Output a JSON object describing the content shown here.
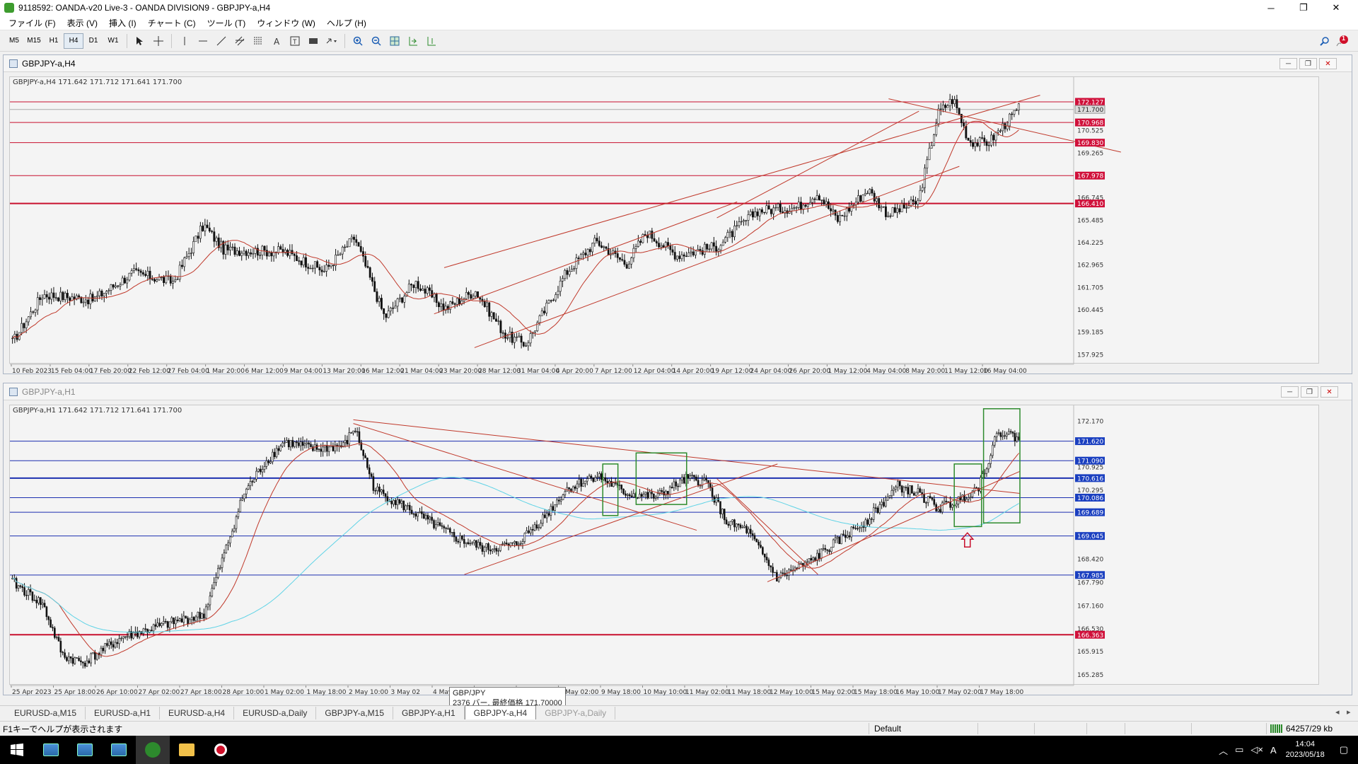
{
  "window": {
    "title": "9118592: OANDA-v20 Live-3 - OANDA DIVISION9 - GBPJPY-a,H4",
    "controls": {
      "minimize": "─",
      "restore": "❐",
      "close": "✕"
    }
  },
  "menu": [
    "ファイル (F)",
    "表示 (V)",
    "挿入 (I)",
    "チャート (C)",
    "ツール (T)",
    "ウィンドウ (W)",
    "ヘルプ (H)"
  ],
  "toolbar": {
    "timeframes": [
      "M5",
      "M15",
      "H1",
      "H4",
      "D1",
      "W1"
    ],
    "active_timeframe": "H4",
    "notification_count": "1"
  },
  "top_chart": {
    "window_title": "GBPJPY-a,H4",
    "info_line": "GBPJPY-a,H4  171.642 171.712 171.641 171.700",
    "price_axis": [
      "172.127",
      "171.700",
      "170.968",
      "170.525",
      "169.830",
      "169.265",
      "167.978",
      "166.745",
      "166.410",
      "165.485",
      "164.225",
      "162.965",
      "161.705",
      "160.445",
      "159.185",
      "157.925"
    ],
    "highlighted_prices": [
      "172.127",
      "170.968",
      "169.830",
      "167.978",
      "166.410"
    ],
    "current_price": "171.700",
    "time_axis": [
      "10 Feb 2023",
      "15 Feb 04:00",
      "17 Feb 20:00",
      "22 Feb 12:00",
      "27 Feb 04:00",
      "1 Mar 20:00",
      "6 Mar 12:00",
      "9 Mar 04:00",
      "13 Mar 20:00",
      "16 Mar 12:00",
      "21 Mar 04:00",
      "23 Mar 20:00",
      "28 Mar 12:00",
      "31 Mar 04:00",
      "4 Apr 20:00",
      "7 Apr 12:00",
      "12 Apr 04:00",
      "14 Apr 20:00",
      "19 Apr 12:00",
      "24 Apr 04:00",
      "26 Apr 20:00",
      "1 May 12:00",
      "4 May 04:00",
      "8 May 20:00",
      "11 May 12:00",
      "16 May 04:00"
    ]
  },
  "bottom_chart": {
    "window_title": "GBPJPY-a,H1",
    "info_line": "GBPJPY-a,H1  171.642 171.712 171.641 171.700",
    "price_axis": [
      "172.170",
      "171.620",
      "171.090",
      "170.925",
      "170.616",
      "170.295",
      "170.086",
      "169.689",
      "169.045",
      "168.420",
      "167.985",
      "167.790",
      "167.160",
      "166.530",
      "166.363",
      "165.915",
      "165.285"
    ],
    "highlighted_prices": [
      "171.620",
      "171.090",
      "170.616",
      "170.086",
      "169.689",
      "169.045",
      "167.985",
      "166.363"
    ],
    "time_axis": [
      "25 Apr 2023",
      "25 Apr 18:00",
      "26 Apr 10:00",
      "27 Apr 02:00",
      "27 Apr 18:00",
      "28 Apr 10:00",
      "1 May 02:00",
      "1 May 18:00",
      "2 May 10:00",
      "3 May 02",
      "4 May 02:00",
      "5 May 18:00",
      "8 May 10:00",
      "9 May 02:00",
      "9 May 18:00",
      "10 May 10:00",
      "11 May 02:00",
      "11 May 18:00",
      "12 May 10:00",
      "15 May 02:00",
      "15 May 18:00",
      "16 May 10:00",
      "17 May 02:00",
      "17 May 18:00"
    ],
    "tooltip": {
      "line1": "GBP/JPY",
      "line2": "2376 バー, 最終価格 171.70000"
    }
  },
  "tabs": [
    "EURUSD-a,M15",
    "EURUSD-a,H1",
    "EURUSD-a,H4",
    "EURUSD-a,Daily",
    "GBPJPY-a,M15",
    "GBPJPY-a,H1",
    "GBPJPY-a,H4",
    "GBPJPY-a,Daily"
  ],
  "active_tab": "GBPJPY-a,H4",
  "status": {
    "help_text": "F1キーでヘルプが表示されます",
    "profile": "Default",
    "traffic": "64257/29 kb"
  },
  "taskbar": {
    "time": "14:04",
    "date": "2023/05/18",
    "ime": "A"
  },
  "icons": {
    "start": "windows-icon",
    "search": "search-icon",
    "bell": "notification-icon"
  },
  "colors": {
    "candle": "#111111",
    "ma_red": "#c0392b",
    "level_red": "#c8102e",
    "level_blue": "#1c2fb0",
    "ma_cyan": "#5fd3e6",
    "box_green": "#2e8b2e",
    "price_tag_red": "#d0103a",
    "price_tag_blue": "#1a3fc0"
  }
}
